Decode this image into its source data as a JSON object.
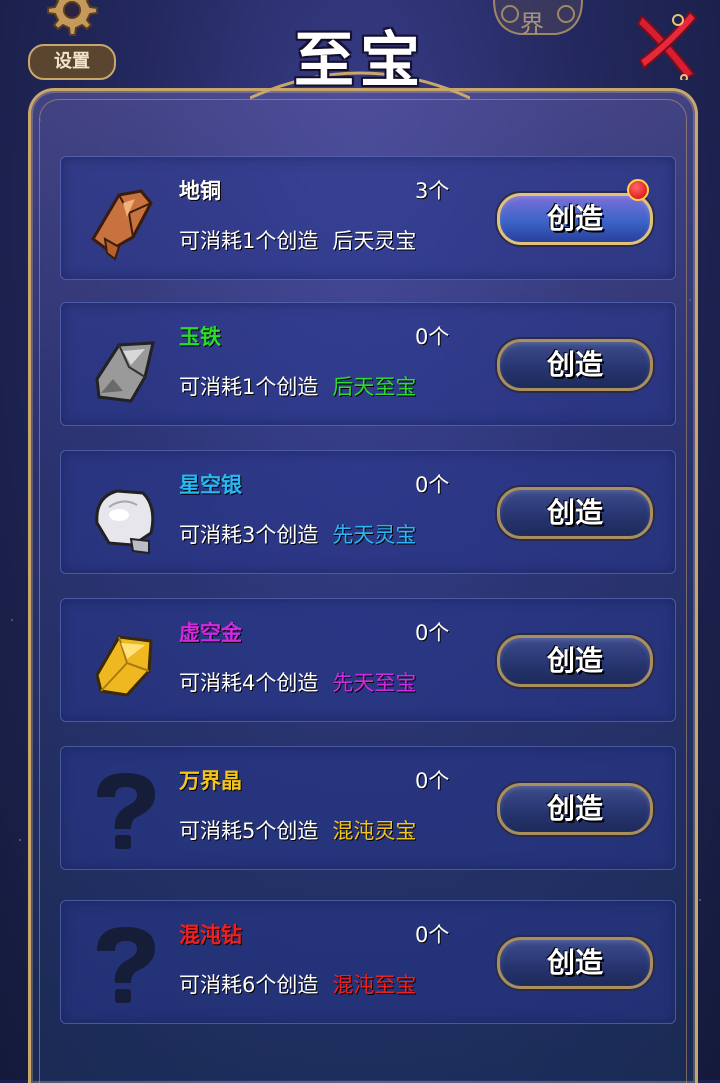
{
  "header": {
    "settings_label": "设置",
    "world_label": "界",
    "title": "至宝"
  },
  "items": [
    {
      "name": "地铜",
      "count": "3个",
      "desc": "可消耗1个创造",
      "kind": "后天灵宝",
      "button": "创造",
      "name_color": "#ffffff",
      "kind_color": "#ffffff",
      "icon": "copper-ore-icon",
      "has_badge": true
    },
    {
      "name": "玉铁",
      "count": "0个",
      "desc": "可消耗1个创造",
      "kind": "后天至宝",
      "button": "创造",
      "name_color": "#2bdc2b",
      "kind_color": "#2bdc2b",
      "icon": "iron-ore-icon",
      "has_badge": false
    },
    {
      "name": "星空银",
      "count": "0个",
      "desc": "可消耗3个创造",
      "kind": "先天灵宝",
      "button": "创造",
      "name_color": "#2bb7f0",
      "kind_color": "#2bb7f0",
      "icon": "silver-ore-icon",
      "has_badge": false
    },
    {
      "name": "虚空金",
      "count": "0个",
      "desc": "可消耗4个创造",
      "kind": "先天至宝",
      "button": "创造",
      "name_color": "#d12be0",
      "kind_color": "#d12be0",
      "icon": "gold-crystal-icon",
      "has_badge": false
    },
    {
      "name": "万界晶",
      "count": "0个",
      "desc": "可消耗5个创造",
      "kind": "混沌灵宝",
      "button": "创造",
      "name_color": "#f3c51c",
      "kind_color": "#f3c51c",
      "icon": "unknown-question-icon",
      "has_badge": false
    },
    {
      "name": "混沌钻",
      "count": "0个",
      "desc": "可消耗6个创造",
      "kind": "混沌至宝",
      "button": "创造",
      "name_color": "#f02020",
      "kind_color": "#f02020",
      "icon": "unknown-question-icon",
      "has_badge": false
    }
  ]
}
